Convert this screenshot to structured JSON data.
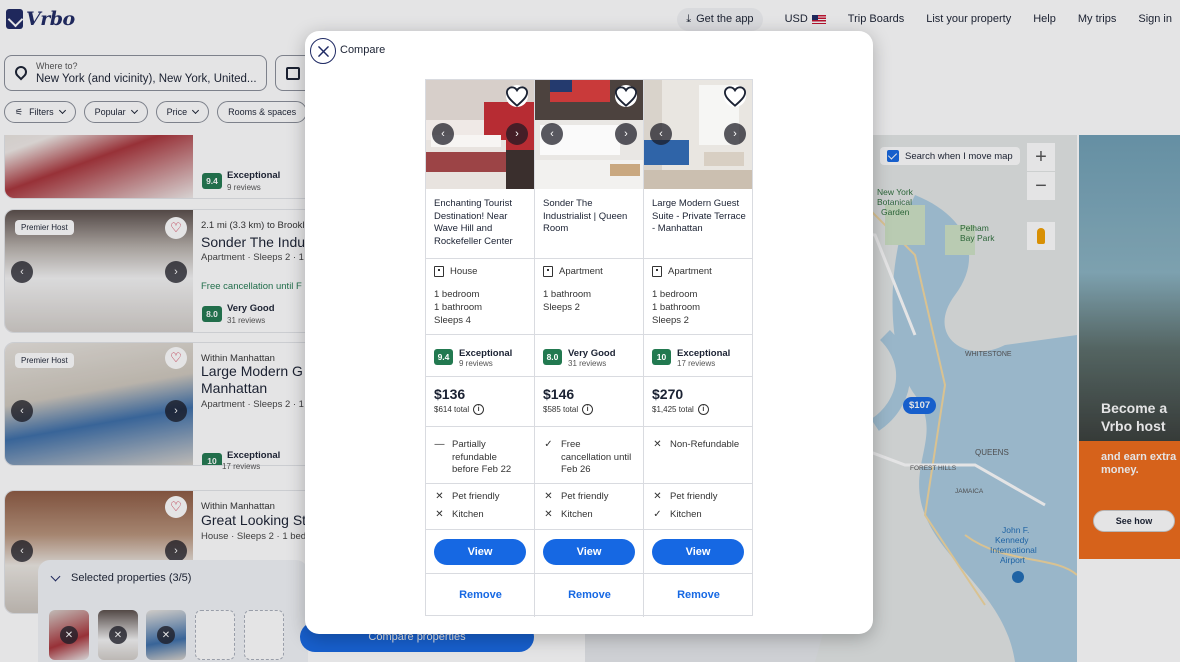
{
  "header": {
    "logo": "Vrbo",
    "get_app": "Get the app",
    "currency": "USD",
    "nav": [
      "Trip Boards",
      "List your property",
      "Help",
      "My trips",
      "Sign in"
    ]
  },
  "search": {
    "where_label": "Where to?",
    "where_value": "New York (and vicinity), New York, United..."
  },
  "filters": [
    "Filters",
    "Popular",
    "Price",
    "Rooms & spaces"
  ],
  "listings": [
    {
      "score": "9.4",
      "score_label": "Exceptional",
      "reviews": "9 reviews"
    },
    {
      "badge": "Premier Host",
      "distance": "2.1 mi (3.3 km) to Brookl",
      "name": "Sonder The Indu",
      "sub": "Apartment · Sleeps 2 · 1",
      "free": "Free cancellation until F",
      "score": "8.0",
      "score_label": "Very Good",
      "reviews": "31 reviews"
    },
    {
      "badge": "Premier Host",
      "distance": "Within Manhattan",
      "name": "Large Modern G",
      "name2": "Manhattan",
      "sub": "Apartment · Sleeps 2 · 1",
      "score": "10",
      "score_label": "Exceptional",
      "reviews": "17 reviews"
    },
    {
      "distance": "Within Manhattan",
      "name": "Great Looking St",
      "sub": "House · Sleeps 2 · 1 bed"
    }
  ],
  "selected": {
    "title": "Selected properties (3/5)",
    "compare_label": "Compare properties"
  },
  "map": {
    "search_when_move": "Search when I move map",
    "price_pin": "$107"
  },
  "ad": {
    "headline": "Become a Vrbo host",
    "sub": "and earn extra money.",
    "cta": "See how"
  },
  "modal": {
    "title": "Compare",
    "columns": [
      {
        "title": "Enchanting Tourist Destination! Near Wave Hill and Rockefeller Center",
        "type": "House",
        "rooms": [
          "1 bedroom",
          "1 bathroom",
          "Sleeps 4"
        ],
        "score": "9.4",
        "score_label": "Exceptional",
        "reviews": "9 reviews",
        "price": "$136",
        "total": "$614 total",
        "cancel_icon": "dash",
        "cancel": "Partially refundable before Feb 22",
        "pet_friendly": false,
        "kitchen": false,
        "view_label": "View",
        "remove_label": "Remove"
      },
      {
        "title": "Sonder The Industrialist | Queen Room",
        "type": "Apartment",
        "rooms": [
          "1 bathroom",
          "Sleeps 2"
        ],
        "score": "8.0",
        "score_label": "Very Good",
        "reviews": "31 reviews",
        "price": "$146",
        "total": "$585 total",
        "cancel_icon": "check",
        "cancel": "Free cancellation until Feb 26",
        "pet_friendly": false,
        "kitchen": false,
        "view_label": "View",
        "remove_label": "Remove"
      },
      {
        "title": "Large Modern Guest Suite - Private Terrace - Manhattan",
        "type": "Apartment",
        "rooms": [
          "1 bedroom",
          "1 bathroom",
          "Sleeps 2"
        ],
        "score": "10",
        "score_label": "Exceptional",
        "reviews": "17 reviews",
        "price": "$270",
        "total": "$1,425 total",
        "cancel_icon": "x",
        "cancel": "Non-Refundable",
        "pet_friendly": false,
        "kitchen": true,
        "view_label": "View",
        "remove_label": "Remove"
      }
    ],
    "amenity_labels": {
      "pet": "Pet friendly",
      "kitchen": "Kitchen"
    }
  },
  "colors": {
    "primary": "#1668e3",
    "score": "#227950",
    "brand": "#1f2a64",
    "ad": "#f06b1a"
  }
}
